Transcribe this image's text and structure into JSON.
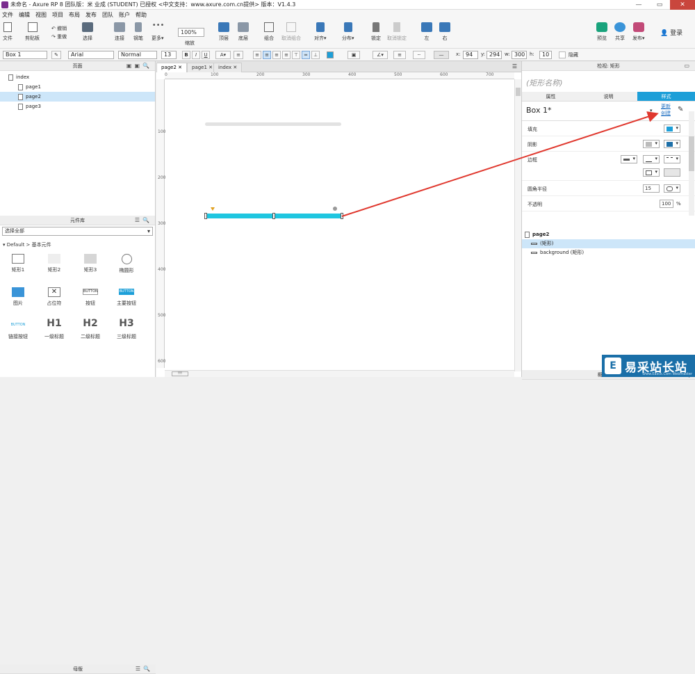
{
  "window": {
    "title": "未命名 - Axure RP 8 团队版：米 业成 (STUDENT) 已授权     <中文支持：www.axure.com.cn提供> 版本：V1.4.3",
    "minimize": "—",
    "maximize": "▭",
    "close": "✕"
  },
  "menu": [
    "文件",
    "编辑",
    "视图",
    "项目",
    "布局",
    "发布",
    "团队",
    "账户",
    "帮助"
  ],
  "toolbar": {
    "file": "文件",
    "clipboard": "剪贴板",
    "undo": "撤销",
    "redo": "重做",
    "select": "选择",
    "connect": "连接",
    "pen": "钢笔",
    "more": "更多▾",
    "zoom_value": "100%",
    "zoom_label": "缩放",
    "top": "顶层",
    "bottom": "底层",
    "group": "组合",
    "ungroup": "取消组合",
    "align": "对齐▾",
    "distribute": "分布▾",
    "lock": "锁定",
    "unlock": "取消锁定",
    "left": "左",
    "right": "右",
    "preview": "预览",
    "share": "共享",
    "publish": "发布▾",
    "login": "登录"
  },
  "formatbar": {
    "widget_name": "Box 1",
    "font": "Arial",
    "style": "Normal",
    "size": "13",
    "bold": "B",
    "italic": "I",
    "underline": "U",
    "x_label": "x:",
    "x_value": "94",
    "y_label": "y:",
    "y_value": "294",
    "w_label": "w:",
    "w_value": "300",
    "h_label": "h:",
    "h_value": "10",
    "hidden_label": "隐藏"
  },
  "pages_panel": {
    "title": "页面",
    "items": [
      {
        "label": "index",
        "indent": 0,
        "selected": false
      },
      {
        "label": "page1",
        "indent": 1,
        "selected": false
      },
      {
        "label": "page2",
        "indent": 1,
        "selected": true
      },
      {
        "label": "page3",
        "indent": 1,
        "selected": false
      }
    ]
  },
  "library_panel": {
    "title": "元件库",
    "selector": "选择全部",
    "category": "Default > 基本元件",
    "widgets": [
      "矩形1",
      "矩形2",
      "矩形3",
      "椭圆形",
      "图片",
      "占位符",
      "按钮",
      "主要按钮",
      "链接按钮",
      "一级标题",
      "二级标题",
      "三级标题"
    ],
    "heading_glyphs": [
      "H1",
      "H2",
      "H3"
    ],
    "button_glyph": "BUTTON"
  },
  "masters_panel": {
    "title": "母版"
  },
  "canvas": {
    "tabs": [
      {
        "label": "page2",
        "active": true
      },
      {
        "label": "page1",
        "active": false
      },
      {
        "label": "index",
        "active": false
      }
    ],
    "ruler_h": [
      "0",
      "100",
      "200",
      "300",
      "400",
      "500",
      "600",
      "700"
    ],
    "ruler_v": [
      "100",
      "200",
      "300",
      "400",
      "500",
      "600"
    ],
    "bottom_tab": "!!!",
    "shape_color": "#1fc6e0"
  },
  "inspector": {
    "title": "检视: 矩形",
    "shape_name_placeholder": "(矩形名称)",
    "tabs": [
      {
        "label": "属性",
        "active": false
      },
      {
        "label": "说明",
        "active": false
      },
      {
        "label": "样式",
        "active": true
      }
    ],
    "style_name": "Box 1*",
    "update_link": "更新",
    "create_link": "创建",
    "rows": {
      "fill": "填充",
      "shadow": "阴影",
      "border": "边框",
      "radius": "圆角半径",
      "radius_value": "15",
      "opacity": "不透明",
      "opacity_value": "100",
      "opacity_unit": "%"
    },
    "fill_color": "#1d9fd8",
    "accent": "#1d9fd8"
  },
  "outline_panel": {
    "title": "概要: 页面",
    "page": "page2",
    "items": [
      {
        "label": "(矩形)",
        "selected": true
      },
      {
        "label": "background (矩形)",
        "selected": false
      }
    ]
  },
  "watermark": {
    "logo": "E",
    "text": "易采站长站",
    "sub": "Www.Easck.Com  Webmaster"
  },
  "annotation_color": "#e0382e"
}
